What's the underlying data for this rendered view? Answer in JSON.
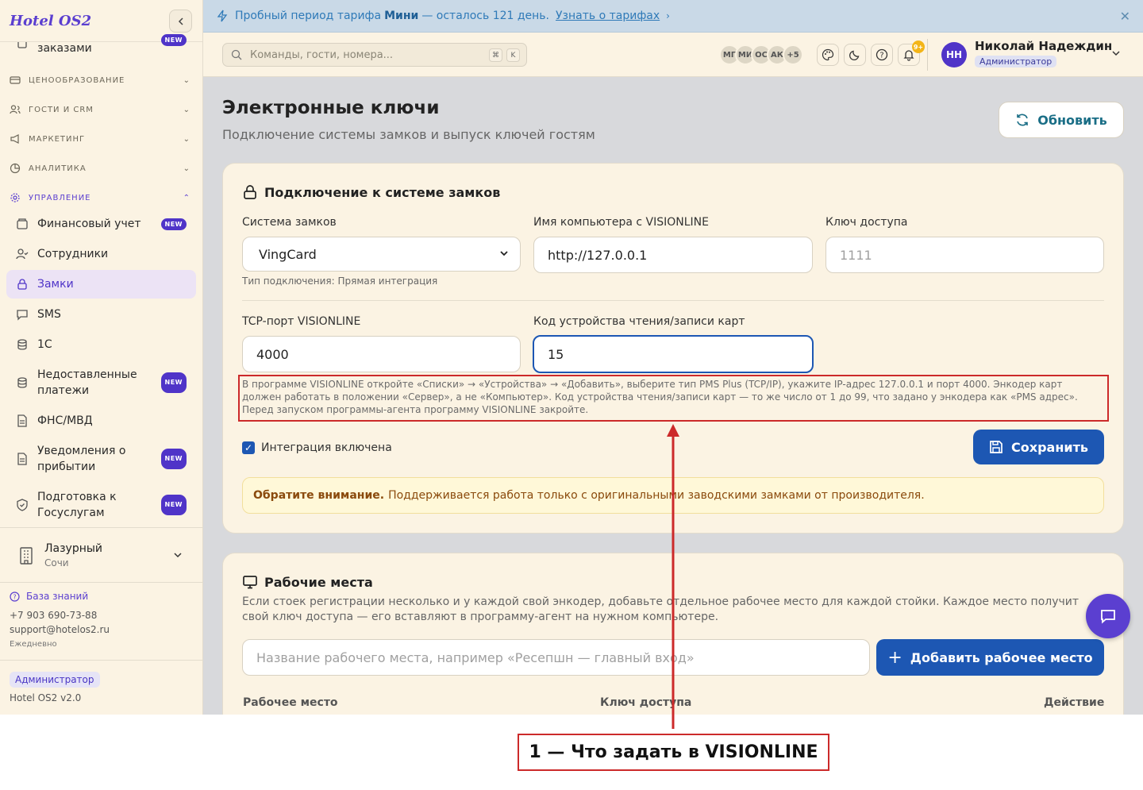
{
  "sidebar": {
    "brand": "Hotel OS2",
    "top_item": {
      "label": "заказами"
    },
    "sections": [
      {
        "label": "ЦЕНООБРАЗОВАНИЕ",
        "icon": "card-icon"
      },
      {
        "label": "ГОСТИ И CRM",
        "icon": "users-icon"
      },
      {
        "label": "МАРКЕТИНГ",
        "icon": "megaphone-icon"
      },
      {
        "label": "АНАЛИТИКА",
        "icon": "chart-pie-icon"
      },
      {
        "label": "УПРАВЛЕНИЕ",
        "icon": "gear-icon"
      }
    ],
    "items": [
      {
        "label": "Финансовый учет",
        "badge": "NEW"
      },
      {
        "label": "Сотрудники"
      },
      {
        "label": "Замки"
      },
      {
        "label": "SMS"
      },
      {
        "label": "1С"
      },
      {
        "label": "Недоставленные платежи",
        "badge": "NEW"
      },
      {
        "label": "ФНС/МВД"
      },
      {
        "label": "Уведомления о прибытии",
        "badge": "NEW"
      },
      {
        "label": "Подготовка к Госуслугам",
        "badge": "NEW"
      }
    ],
    "hotel": {
      "name": "Лазурный",
      "city": "Сочи"
    },
    "knowledge_base": "База знаний",
    "phone": "+7 903 690-73-88",
    "email": "support@hotelos2.ru",
    "schedule": "Ежедневно",
    "role": "Администратор",
    "version": "Hotel OS2 v2.0"
  },
  "banner": {
    "text_before": "Пробный период тарифа",
    "plan": "Мини",
    "text_after": "— осталось 121 день.",
    "link": "Узнать о тарифах"
  },
  "header": {
    "search_placeholder": "Команды, гости, номера...",
    "kbd1": "⌘",
    "kbd2": "K",
    "avatars": [
      "МГ",
      "МИ",
      "ОС",
      "АК",
      "+5"
    ],
    "notif_count": "9+",
    "user_initials": "НН",
    "user_name": "Николай Надеждин",
    "user_role": "Администратор"
  },
  "page": {
    "title": "Электронные ключи",
    "subtitle": "Подключение системы замков и выпуск ключей гостям",
    "refresh": "Обновить"
  },
  "lock_card": {
    "title": "Подключение к системе замков",
    "lock_system_label": "Система замков",
    "lock_system_value": "VingCard",
    "connection_type": "Тип подключения: Прямая интеграция",
    "computer_label": "Имя компьютера с VISIONLINE",
    "computer_value": "http://127.0.0.1",
    "access_key_label": "Ключ доступа",
    "access_key_placeholder": "1111",
    "tcp_label": "TCP-порт VISIONLINE",
    "tcp_value": "4000",
    "encoder_label": "Код устройства чтения/записи карт",
    "encoder_value": "15",
    "help": "В программе VISIONLINE откройте «Списки» → «Устройства» → «Добавить», выберите тип PMS Plus (TCP/IP), укажите IP-адрес 127.0.0.1 и порт 4000. Энкодер карт должен работать в положении «Сервер», а не «Компьютер». Код устройства чтения/записи карт — то же число от 1 до 99, что задано у энкодера как «PMS адрес». Перед запуском программы-агента программу VISIONLINE закройте.",
    "integration_enabled": "Интеграция включена",
    "save": "Сохранить",
    "notice_bold": "Обратите внимание.",
    "notice_text": "Поддерживается работа только с оригинальными заводскими замками от производителя."
  },
  "workplaces_card": {
    "title": "Рабочие места",
    "description": "Если стоек регистрации несколько и у каждой свой энкодер, добавьте отдельное рабочее место для каждой стойки. Каждое место получит свой ключ доступа — его вставляют в программу-агент на нужном компьютере.",
    "input_placeholder": "Название рабочего места, например «Ресепшн — главный вход»",
    "add_button": "Добавить рабочее место",
    "columns": [
      "Рабочее место",
      "Ключ доступа",
      "Действие"
    ]
  },
  "annotation": {
    "label": "1 — Что задать в VISIONLINE",
    "color": "#cc2a2a"
  }
}
